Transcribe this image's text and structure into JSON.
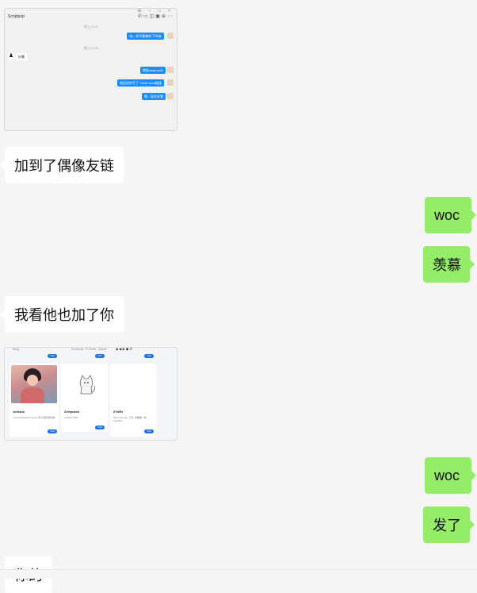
{
  "screenshot_chat": {
    "title": "Scoplpop",
    "icons": [
      "phone-icon",
      "folder-icon",
      "window-icon",
      "image-icon",
      "add-icon",
      "more-icon"
    ],
    "time_1": "晚上10:21",
    "msg_1": "哈，你不都做的了吗😂",
    "time_2": "晚上10:25",
    "msg_2": "好嘞",
    "msg_3": "就挂zeakuanki",
    "msg_4": "我还给你写了 VIAW word链接",
    "msg_5": "嗯，现在好看"
  },
  "messages": {
    "m1": "加到了偶像友链",
    "m2": "woc",
    "m3": "羡慕",
    "m4": "我看他也加了你",
    "m5": "woc",
    "m6": "发了",
    "m7": "你的"
  },
  "screenshot_links": {
    "site": "Blog",
    "nav": [
      "Archives",
      "Friends",
      "About"
    ],
    "visit_label": "Visit",
    "cards": [
      {
        "name": "Jeekuto",
        "desc": "A Front-Develop Crypto 离子量也很简单"
      },
      {
        "name": "Zerfpeach",
        "desc": "Contact Web"
      },
      {
        "name": "ZYoRe",
        "desc": "Web Security, 工作, 也要做一些, 1yb22x1"
      }
    ]
  }
}
